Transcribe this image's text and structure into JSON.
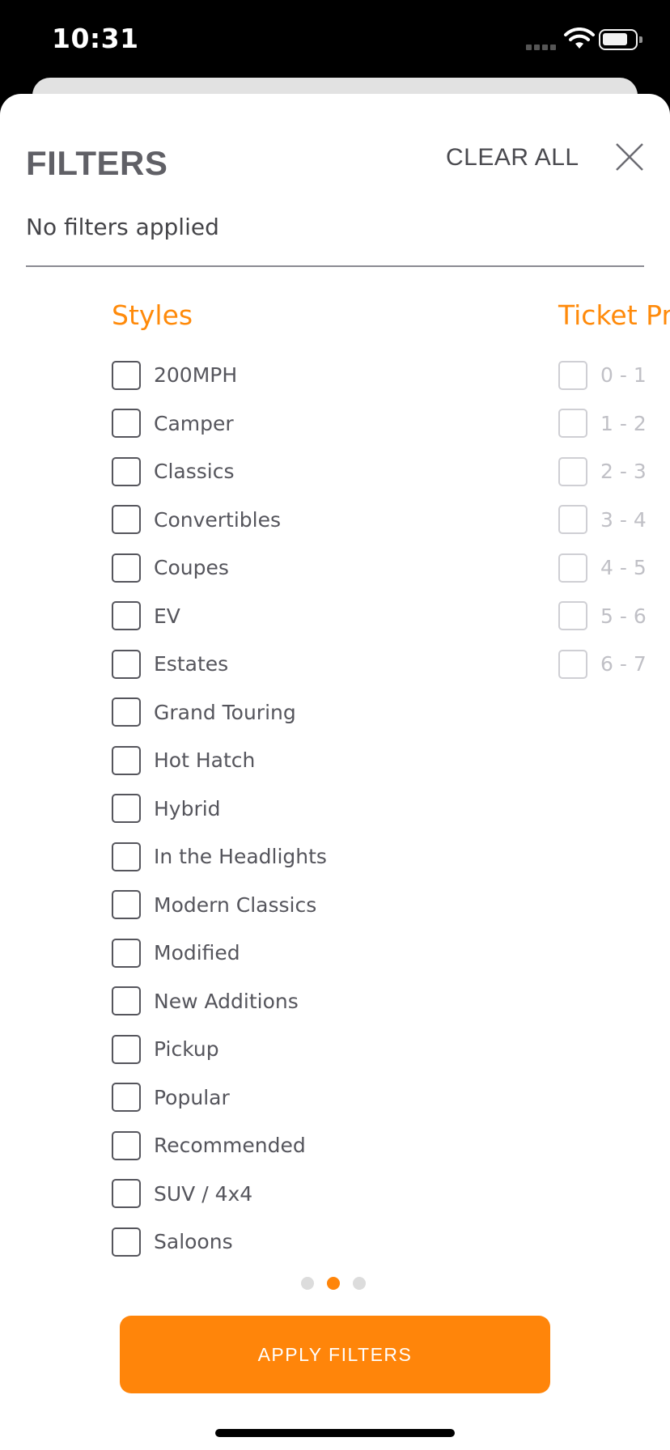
{
  "status_bar": {
    "time": "10:31"
  },
  "header": {
    "title": "FILTERS",
    "clear_all": "CLEAR ALL",
    "subtitle": "No filters applied"
  },
  "styles": {
    "heading": "Styles",
    "options": [
      "200MPH",
      "Camper",
      "Classics",
      "Convertibles",
      "Coupes",
      "EV",
      "Estates",
      "Grand Touring",
      "Hot Hatch",
      "Hybrid",
      "In the Headlights",
      "Modern Classics",
      "Modified",
      "New Additions",
      "Pickup",
      "Popular",
      "Recommended",
      "SUV / 4x4",
      "Saloons"
    ]
  },
  "ticket_price": {
    "heading": "Ticket Pr",
    "options": [
      "0 - 1",
      "1 - 2",
      "2 - 3",
      "3 - 4",
      "4 - 5",
      "5 - 6",
      "6 - 7"
    ]
  },
  "pagination": {
    "count": 3,
    "active_index": 1
  },
  "apply_button": "APPLY FILTERS",
  "colors": {
    "accent": "#ff850a",
    "text": "#55555c",
    "disabled": "#c0c0c6"
  }
}
